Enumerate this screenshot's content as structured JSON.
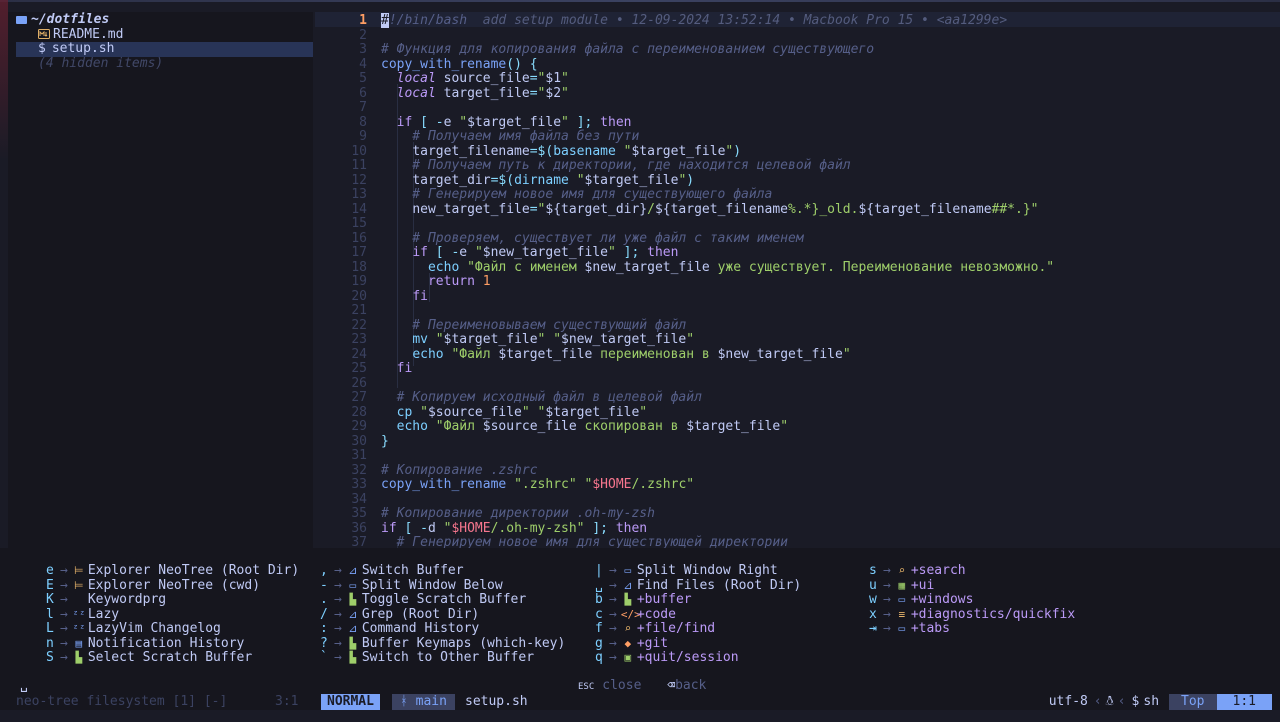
{
  "sidebar": {
    "root_label": "~/dotfiles",
    "items": [
      {
        "name": "README.md",
        "icon": "markdown-icon"
      },
      {
        "name": "setup.sh",
        "icon": "shell-icon",
        "selected": true
      }
    ],
    "hidden_label": "(4 hidden items)"
  },
  "editor": {
    "blame": "add setup module • 12-09-2024 13:52:14 • Macbook Pro 15 • <aa1299e>",
    "lines": [
      {
        "n": "1",
        "t": "#!/bin/bash"
      },
      {
        "n": "2",
        "t": ""
      },
      {
        "n": "3",
        "t": "# Функция для копирования файла с переименованием существующего"
      },
      {
        "n": "4",
        "t": "copy_with_rename() {"
      },
      {
        "n": "5",
        "t": "  local source_file=\"$1\""
      },
      {
        "n": "6",
        "t": "  local target_file=\"$2\""
      },
      {
        "n": "7",
        "t": ""
      },
      {
        "n": "8",
        "t": "  if [ -e \"$target_file\" ]; then"
      },
      {
        "n": "9",
        "t": "    # Получаем имя файла без пути"
      },
      {
        "n": "10",
        "t": "    target_filename=$(basename \"$target_file\")"
      },
      {
        "n": "11",
        "t": "    # Получаем путь к директории, где находится целевой файл"
      },
      {
        "n": "12",
        "t": "    target_dir=$(dirname \"$target_file\")"
      },
      {
        "n": "13",
        "t": "    # Генерируем новое имя для существующего файла"
      },
      {
        "n": "14",
        "t": "    new_target_file=\"${target_dir}/${target_filename%.*}_old.${target_filename##*.}\""
      },
      {
        "n": "15",
        "t": ""
      },
      {
        "n": "16",
        "t": "    # Проверяем, существует ли уже файл с таким именем"
      },
      {
        "n": "17",
        "t": "    if [ -e \"$new_target_file\" ]; then"
      },
      {
        "n": "18",
        "t": "      echo \"Файл с именем $new_target_file уже существует. Переименование невозможно.\""
      },
      {
        "n": "19",
        "t": "      return 1"
      },
      {
        "n": "20",
        "t": "    fi"
      },
      {
        "n": "21",
        "t": ""
      },
      {
        "n": "22",
        "t": "    # Переименовываем существующий файл"
      },
      {
        "n": "23",
        "t": "    mv \"$target_file\" \"$new_target_file\""
      },
      {
        "n": "24",
        "t": "    echo \"Файл $target_file переименован в $new_target_file\""
      },
      {
        "n": "25",
        "t": "  fi"
      },
      {
        "n": "26",
        "t": ""
      },
      {
        "n": "27",
        "t": "  # Копируем исходный файл в целевой файл"
      },
      {
        "n": "28",
        "t": "  cp \"$source_file\" \"$target_file\""
      },
      {
        "n": "29",
        "t": "  echo \"Файл $source_file скопирован в $target_file\""
      },
      {
        "n": "30",
        "t": "}"
      },
      {
        "n": "31",
        "t": ""
      },
      {
        "n": "32",
        "t": "# Копирование .zshrc"
      },
      {
        "n": "33",
        "t": "copy_with_rename \".zshrc\" \"$HOME/.zshrc\""
      },
      {
        "n": "34",
        "t": ""
      },
      {
        "n": "35",
        "t": "# Копирование директории .oh-my-zsh"
      },
      {
        "n": "36",
        "t": "if [ -d \"$HOME/.oh-my-zsh\" ]; then"
      },
      {
        "n": "37",
        "t": "  # Генерируем новое имя для существующей директории"
      }
    ]
  },
  "whichkey": {
    "columns": [
      [
        {
          "key": "e",
          "desc": "Explorer NeoTree (Root Dir)",
          "icon": "tree-icon"
        },
        {
          "key": "E",
          "desc": "Explorer NeoTree (cwd)",
          "icon": "tree-icon"
        },
        {
          "key": "K",
          "desc": "Keywordprg",
          "icon": ""
        },
        {
          "key": "l",
          "desc": "Lazy",
          "icon": "zzz-icon"
        },
        {
          "key": "L",
          "desc": "LazyVim Changelog",
          "icon": "zzz-icon"
        },
        {
          "key": "n",
          "desc": "Notification History",
          "icon": "notification-icon"
        },
        {
          "key": "S",
          "desc": "Select Scratch Buffer",
          "icon": "file-icon"
        }
      ],
      [
        {
          "key": ",",
          "desc": "Switch Buffer",
          "icon": "telescope-icon"
        },
        {
          "key": "-",
          "desc": "Split Window Below",
          "icon": "window-icon"
        },
        {
          "key": ".",
          "desc": "Toggle Scratch Buffer",
          "icon": "file-icon"
        },
        {
          "key": "/",
          "desc": "Grep (Root Dir)",
          "icon": "telescope-icon"
        },
        {
          "key": ":",
          "desc": "Command History",
          "icon": "telescope-icon"
        },
        {
          "key": "?",
          "desc": "Buffer Keymaps (which-key)",
          "icon": "file-icon"
        },
        {
          "key": "`",
          "desc": "Switch to Other Buffer",
          "icon": "file-icon"
        }
      ],
      [
        {
          "key": "|",
          "desc": "Split Window Right",
          "icon": "window-icon"
        },
        {
          "key": "␣",
          "desc": "Find Files (Root Dir)",
          "icon": "telescope-icon"
        },
        {
          "key": "b",
          "desc": "+buffer",
          "icon": "file-icon"
        },
        {
          "key": "c",
          "desc": "+code",
          "icon": "code-icon"
        },
        {
          "key": "f",
          "desc": "+file/find",
          "icon": "search-icon"
        },
        {
          "key": "g",
          "desc": "+git",
          "icon": "git-icon"
        },
        {
          "key": "q",
          "desc": "+quit/session",
          "icon": "save-icon"
        }
      ],
      [
        {
          "key": "s",
          "desc": "+search",
          "icon": "search-icon"
        },
        {
          "key": "u",
          "desc": "+ui",
          "icon": "ui-icon"
        },
        {
          "key": "w",
          "desc": "+windows",
          "icon": "window-icon"
        },
        {
          "key": "x",
          "desc": "+diagnostics/quickfix",
          "icon": "diagnostics-icon"
        },
        {
          "key": "⇥",
          "desc": "+tabs",
          "icon": "tabs-icon"
        }
      ]
    ],
    "footer": {
      "esc_key": "ESC",
      "close": "close",
      "back": "back"
    }
  },
  "statusline": {
    "left": "neo-tree filesystem [1] [-]",
    "left_pos": "3:1",
    "mode": "NORMAL",
    "branch": "main",
    "filename": "setup.sh",
    "encoding": "utf-8",
    "filetype": "sh",
    "progress": "Top",
    "location": "1:1"
  },
  "cmdline": "␣"
}
